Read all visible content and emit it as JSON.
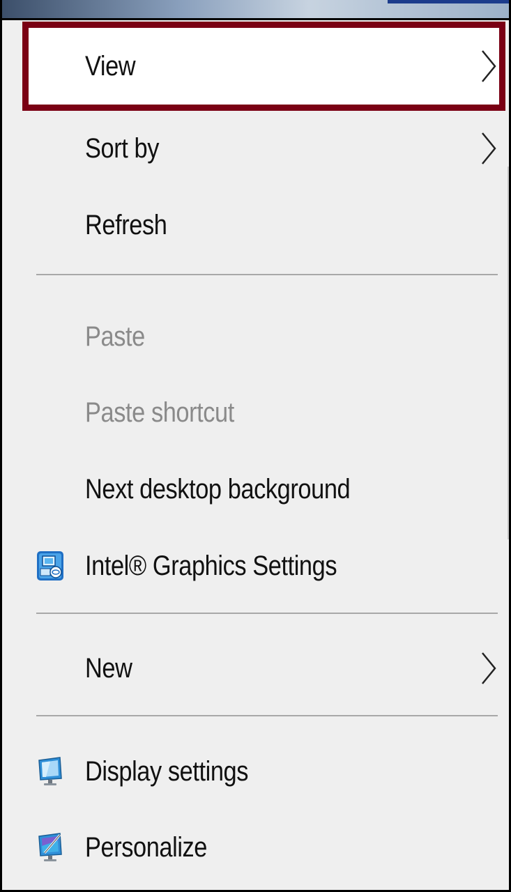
{
  "context_menu": {
    "items": [
      {
        "label": "View",
        "has_submenu": true,
        "disabled": false,
        "highlighted": true
      },
      {
        "label": "Sort by",
        "has_submenu": true,
        "disabled": false
      },
      {
        "label": "Refresh",
        "has_submenu": false,
        "disabled": false
      },
      {
        "label": "Paste",
        "has_submenu": false,
        "disabled": true
      },
      {
        "label": "Paste shortcut",
        "has_submenu": false,
        "disabled": true
      },
      {
        "label": "Next desktop background",
        "has_submenu": false,
        "disabled": false
      },
      {
        "label": "Intel® Graphics Settings",
        "has_submenu": false,
        "disabled": false,
        "icon": "intel-graphics-icon"
      },
      {
        "label": "New",
        "has_submenu": true,
        "disabled": false
      },
      {
        "label": "Display settings",
        "has_submenu": false,
        "disabled": false,
        "icon": "display-settings-icon"
      },
      {
        "label": "Personalize",
        "has_submenu": false,
        "disabled": false,
        "icon": "personalize-icon"
      }
    ]
  },
  "colors": {
    "menu_background": "#efefef",
    "highlight_border": "#7a0014",
    "text": "#111111",
    "disabled_text": "#8a8a8a",
    "separator": "#a8a8a8"
  }
}
